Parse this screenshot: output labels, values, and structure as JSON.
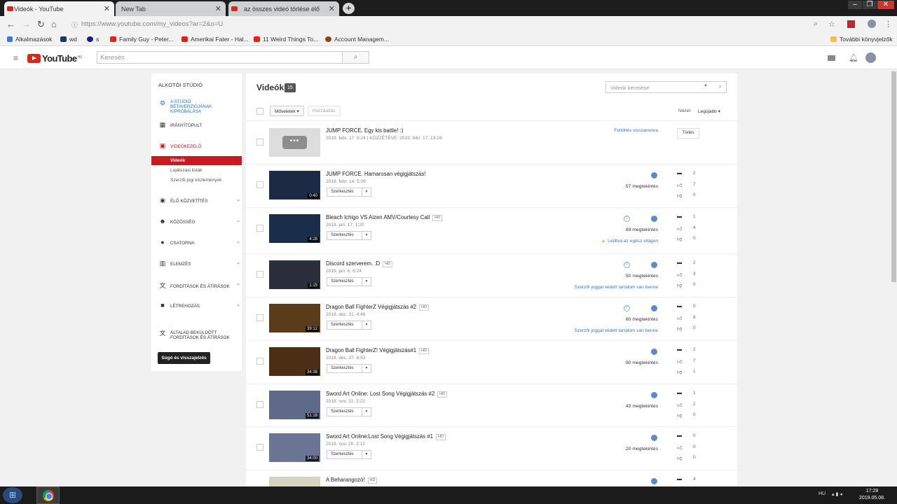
{
  "browser": {
    "tabs": [
      {
        "label": "Videók - YouTube",
        "active": true
      },
      {
        "label": "New Tab",
        "active": false
      },
      {
        "label": "az összes videó törlése élő adásb",
        "active": false
      }
    ],
    "new_tab": "+",
    "url": "https://www.youtube.com/my_videos?ar=2&o=U",
    "bookmarks": [
      "Alkalmazások",
      "wd",
      "s",
      "Family Guy - Peter...",
      "Amerikai Fater - Hal...",
      "11 Weird Things To...",
      "Account Managem..."
    ],
    "other_bookmarks": "További könyvjelzők"
  },
  "youtube": {
    "logo": "YouTube",
    "logo_region": "HU",
    "search_placeholder": "Keresés"
  },
  "sidebar": {
    "title": "ALKOTÓI STÚDIÓ",
    "beta_label": "A STÚDIÓ BÉTAVERZIÓJÁNAK KIPRÓBÁLÁSA",
    "items": [
      {
        "label": "IRÁNYÍTÓPULT",
        "icon": "dashboard-icon"
      },
      {
        "label": "VIDEÓKEZELŐ",
        "icon": "video-manager-icon"
      },
      {
        "label": "ÉLŐ KÖZVETÍTÉS",
        "icon": "live-icon"
      },
      {
        "label": "KÖZÖSSÉG",
        "icon": "community-icon"
      },
      {
        "label": "CSATORNA",
        "icon": "channel-icon"
      },
      {
        "label": "ELEMZÉS",
        "icon": "analytics-icon"
      },
      {
        "label": "FORDÍTÁSOK ÉS ÁTÍRÁSOK",
        "icon": "translate-icon"
      },
      {
        "label": "LÉTREHOZÁS",
        "icon": "create-icon"
      },
      {
        "label": "ÁLTALAD BEKÜLDÖTT FORDÍTÁSOK ÉS ÁTÍRÁSOK",
        "icon": "submitted-icon"
      }
    ],
    "subitems": [
      "Videók",
      "Lejátszási listák",
      "Szerzői jogi közlemények"
    ],
    "help_button": "Súgó és visszajelzés"
  },
  "main": {
    "title": "Videók",
    "count": "15",
    "search_placeholder": "Videók keresése",
    "actions_button": "Műveletek",
    "add_button": "Hozzáadás",
    "sort_label": "Nézet:",
    "sort_value": "Legújabb",
    "edit_label": "Szerkesztés",
    "delete_label": "Törlés",
    "videos": [
      {
        "title": "JUMP FORCE. Egy kis battle! :)",
        "hd": "",
        "date": "2019. febr. 17. 6:24  |  KÖZZÉTÉVE: 2019. febr. 17. 13:24",
        "duration": "",
        "views": "",
        "note": "Feltöltés visszavonva",
        "comments": "",
        "likes": "",
        "dislikes": ""
      },
      {
        "title": "JUMP FORCE. Hamarosan végigjátszás!",
        "hd": "",
        "date": "2019. febr. 14. 5:09",
        "duration": "0:40",
        "views": "57 megtekintés",
        "note": "",
        "comments": "2",
        "likes": "7",
        "dislikes": "0"
      },
      {
        "title": "Bleach Ichigo VS Aizen AMV/Courtesy Call",
        "hd": "HD",
        "date": "2019. jan. 17. 1:20",
        "duration": "4:28",
        "views": "89 megtekintés",
        "note": "Letiltva az egész világon",
        "comments": "1",
        "likes": "4",
        "dislikes": "0"
      },
      {
        "title": "Discord szerverem. :D",
        "hd": "HD",
        "date": "2019. jan. 6. 6:24",
        "duration": "1:15",
        "views": "50 megtekintés",
        "note": "Szerzői joggal védett tartalom van benne",
        "comments": "2",
        "likes": "3",
        "dislikes": "0"
      },
      {
        "title": "Dragon Ball FighterZ Végigjátszás #2",
        "hd": "HD",
        "date": "2018. dec. 31. 4:46",
        "duration": "39:12",
        "views": "60 megtekintés",
        "note": "Szerzői joggal védett tartalom van benne",
        "comments": "0",
        "likes": "6",
        "dislikes": "0"
      },
      {
        "title": "Dragon Ball FighterZ! Végigjátszás#1",
        "hd": "HD",
        "date": "2018. dec. 27. 6:53",
        "duration": "34:38",
        "views": "90 megtekintés",
        "note": "",
        "comments": "2",
        "likes": "7",
        "dislikes": "1"
      },
      {
        "title": "Sword Art Online: Lost Song Végigjátszás #2",
        "hd": "HD",
        "date": "2018. nov. 22. 2:22",
        "duration": "51:18",
        "views": "43 megtekintés",
        "note": "",
        "comments": "1",
        "likes": "2",
        "dislikes": "0"
      },
      {
        "title": "Sword Art Online:Lost Song Végigjátszás #1",
        "hd": "HD",
        "date": "2018. nov. 20. 2:12",
        "duration": "34:00",
        "views": "20 megtekintés",
        "note": "",
        "comments": "0",
        "likes": "0",
        "dislikes": "0"
      },
      {
        "title": "A Beharangozó!",
        "hd": "HD",
        "date": "",
        "duration": "",
        "views": "",
        "note": "",
        "comments": "4",
        "likes": "",
        "dislikes": ""
      }
    ]
  },
  "taskbar": {
    "lang": "HU",
    "time": "17:28",
    "date": "2019.05.08."
  },
  "colors": {
    "accent": "#cc181e",
    "link": "#3a77c9",
    "brand": "#e62117"
  }
}
